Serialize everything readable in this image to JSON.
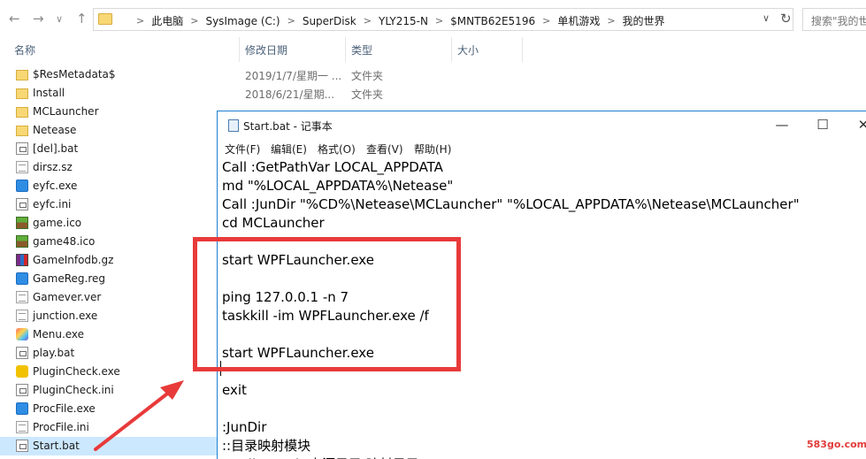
{
  "explorer": {
    "nav": {
      "back": "←",
      "forward": "→",
      "dropdown": "∨",
      "up": "↑"
    },
    "path": [
      "此电脑",
      "SysImage (C:)",
      "SuperDisk",
      "YLY215-N",
      "$MNTB62E5196",
      "单机游戏",
      "我的世界"
    ],
    "path_sep": ">",
    "search_placeholder": "搜索\"我的世",
    "columns": {
      "name": "名称",
      "date": "修改日期",
      "type": "类型",
      "size": "大小"
    },
    "files": [
      {
        "name": "$ResMetadata$",
        "icon": "folder-icon",
        "date": "2019/1/7/星期一 ...",
        "type": "文件夹"
      },
      {
        "name": "Install",
        "icon": "folder-icon",
        "date": "2018/6/21/星期...",
        "type": "文件夹"
      },
      {
        "name": "MCLauncher",
        "icon": "folder-icon",
        "date": "",
        "type": ""
      },
      {
        "name": "Netease",
        "icon": "folder-icon",
        "date": "",
        "type": ""
      },
      {
        "name": "[del].bat",
        "icon": "batch-file-icon",
        "date": "",
        "type": ""
      },
      {
        "name": "dirsz.sz",
        "icon": "document-icon",
        "date": "",
        "type": ""
      },
      {
        "name": "eyfc.exe",
        "icon": "app-blue-icon",
        "date": "",
        "type": ""
      },
      {
        "name": "eyfc.ini",
        "icon": "ini-file-icon",
        "date": "",
        "type": ""
      },
      {
        "name": "game.ico",
        "icon": "minecraft-grass-icon",
        "date": "",
        "type": ""
      },
      {
        "name": "game48.ico",
        "icon": "minecraft-grass-icon",
        "date": "",
        "type": ""
      },
      {
        "name": "GameInfodb.gz",
        "icon": "winrar-archive-icon",
        "date": "",
        "type": ""
      },
      {
        "name": "GameReg.reg",
        "icon": "registry-file-icon",
        "date": "",
        "type": ""
      },
      {
        "name": "Gamever.ver",
        "icon": "document-icon",
        "date": "",
        "type": ""
      },
      {
        "name": "junction.exe",
        "icon": "console-app-icon",
        "date": "",
        "type": ""
      },
      {
        "name": "Menu.exe",
        "icon": "menu-app-icon",
        "date": "",
        "type": ""
      },
      {
        "name": "play.bat",
        "icon": "batch-file-icon",
        "date": "",
        "type": ""
      },
      {
        "name": "PluginCheck.exe",
        "icon": "puzzle-app-icon",
        "date": "",
        "type": ""
      },
      {
        "name": "PluginCheck.ini",
        "icon": "ini-file-icon",
        "date": "",
        "type": ""
      },
      {
        "name": "ProcFile.exe",
        "icon": "app-blue-icon",
        "date": "",
        "type": ""
      },
      {
        "name": "ProcFile.ini",
        "icon": "document-icon",
        "date": "",
        "type": ""
      },
      {
        "name": "Start.bat",
        "icon": "batch-file-icon",
        "date": "",
        "type": "",
        "selected": true
      }
    ]
  },
  "notepad": {
    "title": "Start.bat - 记事本",
    "buttons": {
      "minimize": "—",
      "maximize": "☐",
      "close": "✕"
    },
    "menu": [
      "文件(F)",
      "编辑(E)",
      "格式(O)",
      "查看(V)",
      "帮助(H)"
    ],
    "lines": [
      "Call :GetPathVar LOCAL_APPDATA",
      "md \"%LOCAL_APPDATA%\\Netease\"",
      "Call :JunDir \"%CD%\\Netease\\MCLauncher\" \"%LOCAL_APPDATA%\\Netease\\MCLauncher\"",
      "cd MCLauncher",
      "",
      "start WPFLauncher.exe",
      "",
      "ping 127.0.0.1 -n 7",
      "taskkill -im WPFLauncher.exe /f",
      "",
      "start WPFLauncher.exe",
      "",
      "exit",
      "",
      ":JunDir",
      "::目录映射模块",
      "::Call :JunDir 来源目录 映射目录"
    ]
  },
  "annotation": {
    "box_color": "#e83a3a",
    "arrow_color": "#e83a3a"
  },
  "watermark": "583go.com"
}
